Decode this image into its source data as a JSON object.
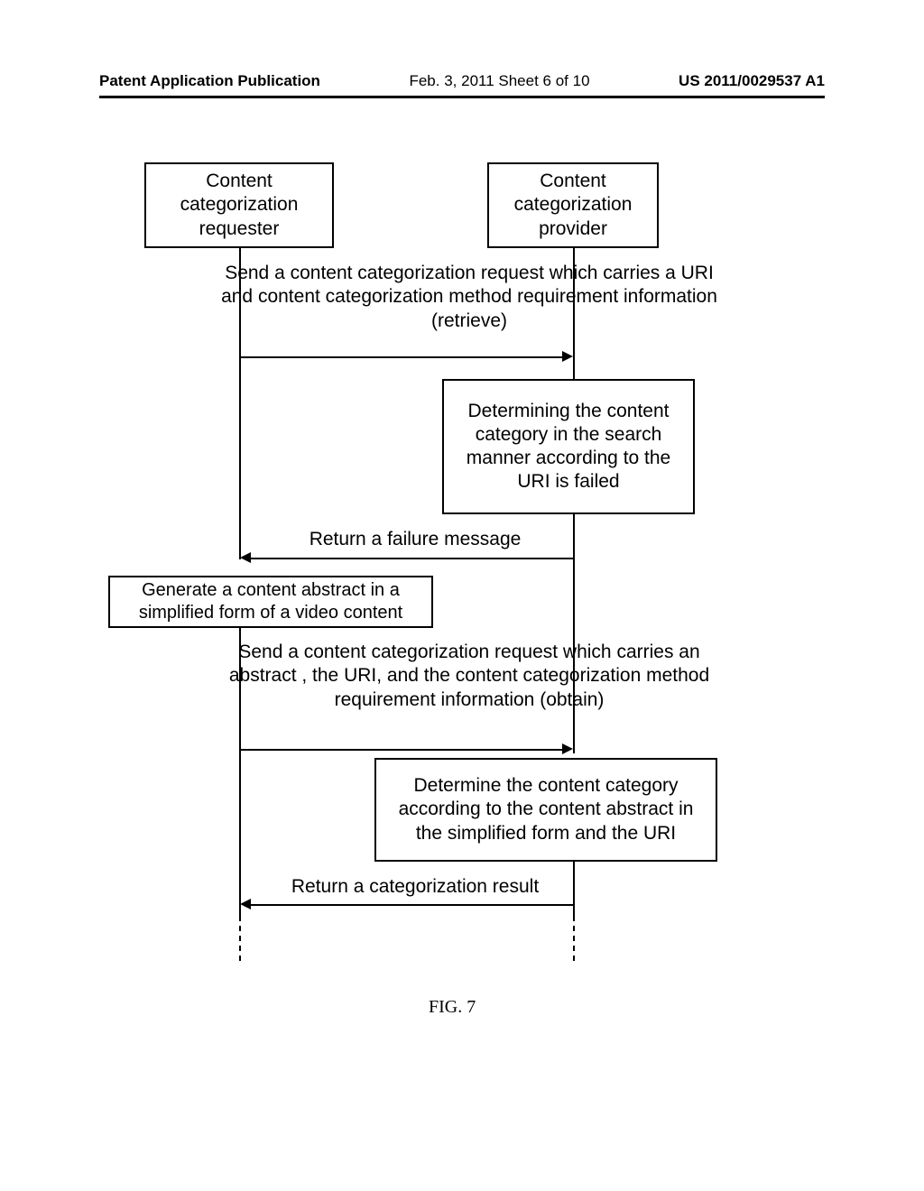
{
  "header": {
    "publication": "Patent Application Publication",
    "date_sheet": "Feb. 3, 2011   Sheet 6 of 10",
    "patent_no": "US 2011/0029537 A1"
  },
  "diagram": {
    "requester_label": "Content categorization requester",
    "provider_label": "Content categorization provider",
    "msg1": "Send a content categorization request which carries a URI and content categorization method requirement information (retrieve)",
    "box1": "Determining the content category in the search manner according to the URI is failed",
    "msg2": "Return a failure message",
    "box2": "Generate a content abstract in a simplified form of a video content",
    "msg3": "Send a content categorization request which carries an abstract , the URI, and the content categorization method requirement information (obtain)",
    "box3": "Determine the content category according to the content abstract in the simplified form and the URI",
    "msg4": "Return a categorization result"
  },
  "figure_label": "FIG. 7"
}
